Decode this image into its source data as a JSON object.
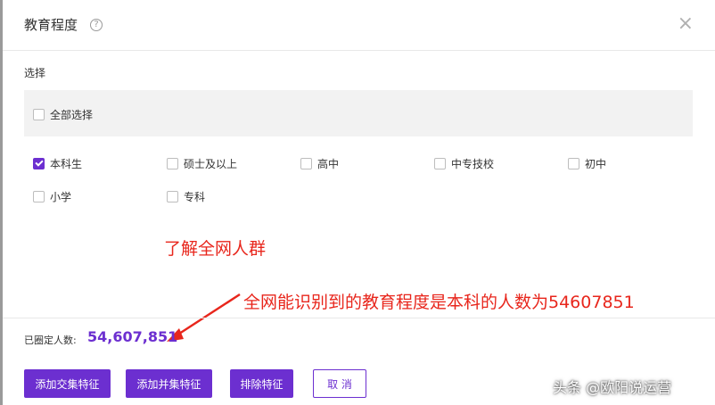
{
  "modal": {
    "title": "教育程度",
    "help_icon": "?",
    "close_icon": "×"
  },
  "selection": {
    "label": "选择",
    "select_all_label": "全部选择",
    "options": [
      {
        "label": "本科生",
        "checked": true
      },
      {
        "label": "硕士及以上",
        "checked": false
      },
      {
        "label": "高中",
        "checked": false
      },
      {
        "label": "中专技校",
        "checked": false
      },
      {
        "label": "初中",
        "checked": false
      },
      {
        "label": "小学",
        "checked": false
      },
      {
        "label": "专科",
        "checked": false
      }
    ]
  },
  "annotations": {
    "note1": "了解全网人群",
    "note2": "全网能识别到的教育程度是本科的人数为54607851"
  },
  "footer": {
    "count_label": "已圈定人数:",
    "count_value": "54,607,851",
    "buttons": {
      "add_intersection": "添加交集特征",
      "add_union": "添加并集特征",
      "exclude": "排除特征",
      "cancel": "取 消"
    }
  },
  "watermark": "头条 @欧阳说运营",
  "colors": {
    "accent": "#6c2fd0",
    "annotation": "#e8261c"
  }
}
